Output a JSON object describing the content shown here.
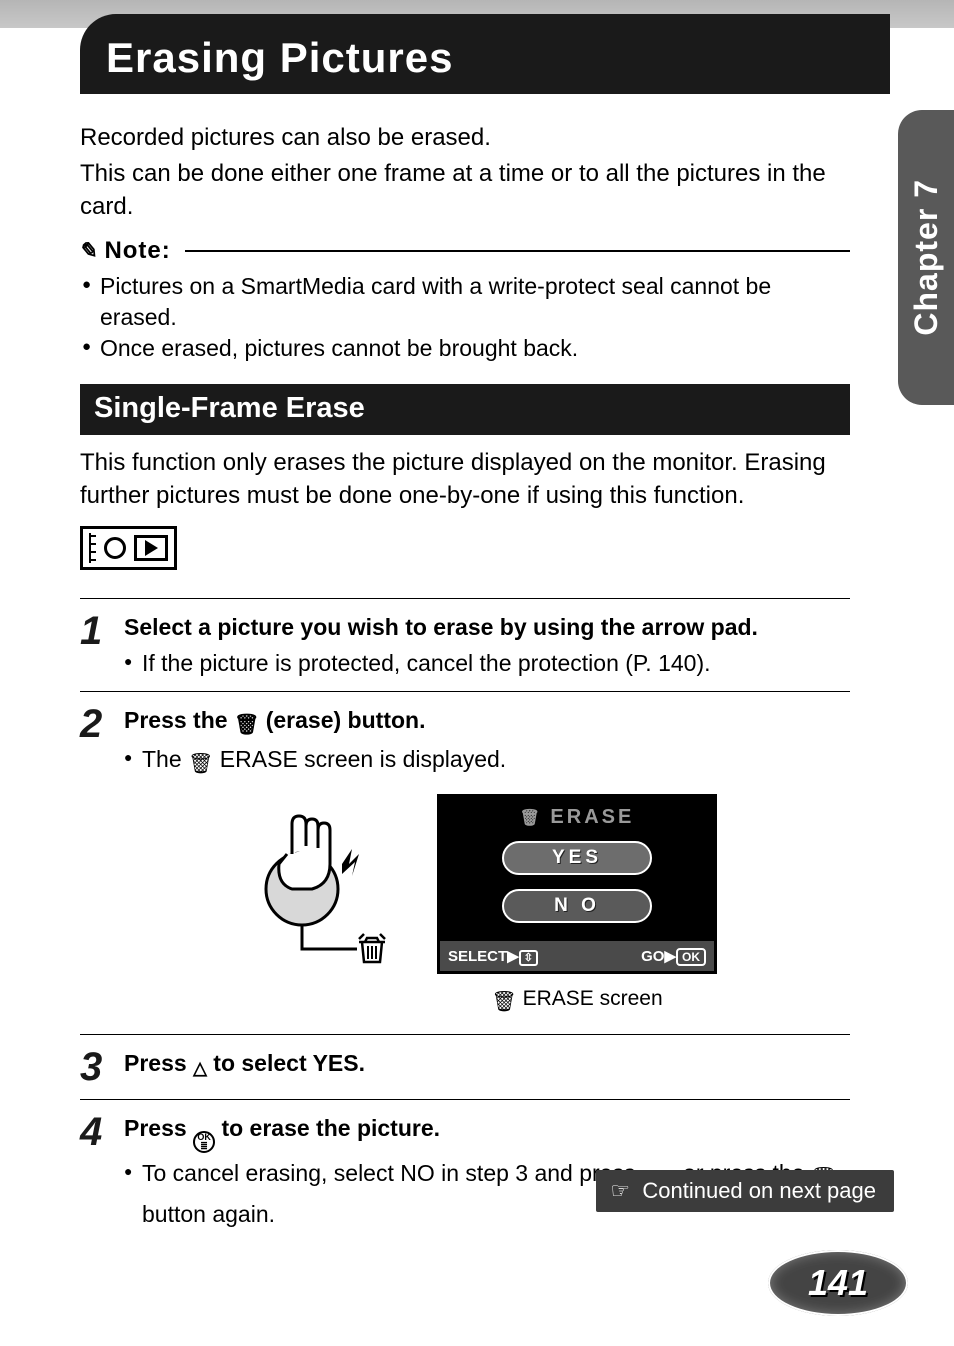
{
  "chapter_tab": "Chapter 7",
  "page_title": "Erasing Pictures",
  "intro": {
    "line1": "Recorded pictures can also be erased.",
    "line2": "This can be done either one frame at a time or to all the pictures in the card."
  },
  "note": {
    "label": "Note:",
    "items": [
      "Pictures on a SmartMedia card with a write-protect seal cannot be erased.",
      "Once erased, pictures cannot be brought back."
    ]
  },
  "section": {
    "heading": "Single-Frame Erase",
    "desc": "This function only erases the picture displayed on the monitor. Erasing further pictures must be done one-by-one if using this function."
  },
  "steps": {
    "s1": {
      "num": "1",
      "title": "Select a picture you wish to erase by using the arrow pad.",
      "sub": "If the picture is protected, cancel the protection (P. 140)."
    },
    "s2": {
      "num": "2",
      "title_pre": "Press the ",
      "title_post": " (erase) button.",
      "sub_pre": "The ",
      "sub_post": " ERASE screen is displayed."
    },
    "s3": {
      "num": "3",
      "title_pre": "Press ",
      "title_post": " to select YES."
    },
    "s4": {
      "num": "4",
      "title_pre": "Press ",
      "title_post": " to erase the picture.",
      "sub_pre": "To cancel erasing, select NO in step 3 and press ",
      "sub_mid": " , or press the ",
      "sub_post": " button again."
    }
  },
  "erase_screen": {
    "title": "ERASE",
    "yes": "YES",
    "no": "N O",
    "select": "SELECT",
    "go": "GO",
    "ok": "OK",
    "caption": " ERASE screen"
  },
  "continued": "Continued on next page",
  "page_number": "141",
  "ok_icon": {
    "top": "OK",
    "bottom": "≣"
  }
}
